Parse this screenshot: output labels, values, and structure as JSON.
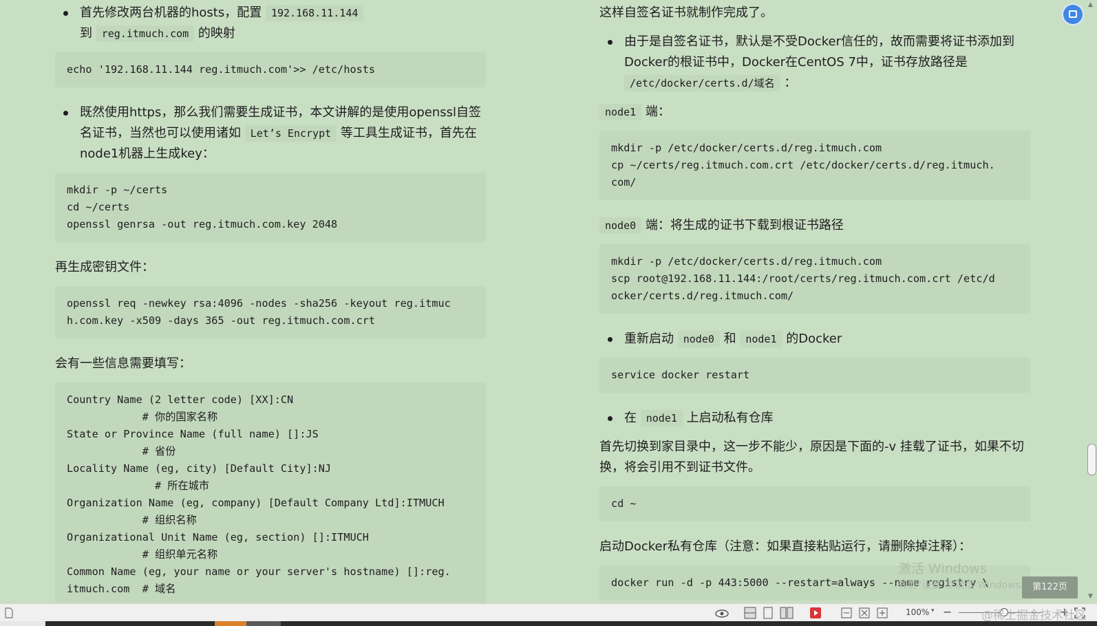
{
  "left": {
    "b1": {
      "t1": "首先修改两台机器的hosts，配置",
      "c1": "192.168.11.144",
      "t2": "到",
      "c2": "reg.itmuch.com",
      "t3": "的映射"
    },
    "code1": "echo '192.168.11.144 reg.itmuch.com'>> /etc/hosts",
    "b2": {
      "t1": "既然使用https，那么我们需要生成证书，本文讲解的是使用openssl自签名证书，当然也可以使用诸如",
      "c1": "Let’s Encrypt",
      "t2": "等工具生成证书，首先在node1机器上生成key："
    },
    "code2": "mkdir -p ~/certs\ncd ~/certs\nopenssl genrsa -out reg.itmuch.com.key 2048",
    "p1": "再生成密钥文件：",
    "code3": "openssl req -newkey rsa:4096 -nodes -sha256 -keyout reg.itmuc\nh.com.key -x509 -days 365 -out reg.itmuch.com.crt",
    "p2": "会有一些信息需要填写：",
    "code4": "Country Name (2 letter code) [XX]:CN\n            # 你的国家名称\nState or Province Name (full name) []:JS\n            # 省份\nLocality Name (eg, city) [Default City]:NJ\n              # 所在城市\nOrganization Name (eg, company) [Default Company Ltd]:ITMUCH\n            # 组织名称\nOrganizational Unit Name (eg, section) []:ITMUCH\n            # 组织单元名称\nCommon Name (eg, your name or your server's hostname) []:reg.\nitmuch.com  # 域名"
  },
  "right": {
    "p0": "这样自签名证书就制作完成了。",
    "b1": {
      "t1": "由于是自签名证书，默认是不受Docker信任的，故而需要将证书添加到Docker的根证书中，Docker在CentOS 7中，证书存放路径是",
      "c1": "/etc/docker/certs.d/域名",
      "t2": "："
    },
    "n1": {
      "c": "node1",
      "t": "端："
    },
    "code1": "mkdir -p /etc/docker/certs.d/reg.itmuch.com\ncp ~/certs/reg.itmuch.com.crt /etc/docker/certs.d/reg.itmuch.\ncom/",
    "n2": {
      "c": "node0",
      "t": "端：将生成的证书下载到根证书路径"
    },
    "code2": "mkdir -p /etc/docker/certs.d/reg.itmuch.com\nscp root@192.168.11.144:/root/certs/reg.itmuch.com.crt /etc/d\nocker/certs.d/reg.itmuch.com/",
    "b2": {
      "t1": "重新启动",
      "c1": "node0",
      "t2": "和",
      "c2": "node1",
      "t3": "的Docker"
    },
    "code3": "service docker restart",
    "b3": {
      "t1": "在",
      "c1": "node1",
      "t2": "上启动私有仓库"
    },
    "p1": "首先切换到家目录中，这一步不能少，原因是下面的-v 挂载了证书，如果不切换，将会引用不到证书文件。",
    "code4": "cd ~",
    "p2": "启动Docker私有仓库（注意：如果直接粘贴运行，请删除掉注释）：",
    "code5": "docker run -d -p 443:5000 --restart=always --name registry \\"
  },
  "overlay": {
    "activate_title": "激活 Windows",
    "activate_sub": "转到\"设置\"以激活 Windows。",
    "page_badge": "第122页",
    "watermark": "@稀土掘金技术社区"
  },
  "statusbar": {
    "zoom": "100%"
  },
  "colors": {
    "page_bg": "#c9dfc4",
    "code_bg": "#c2d8bd",
    "accent": "#3f86e6"
  }
}
